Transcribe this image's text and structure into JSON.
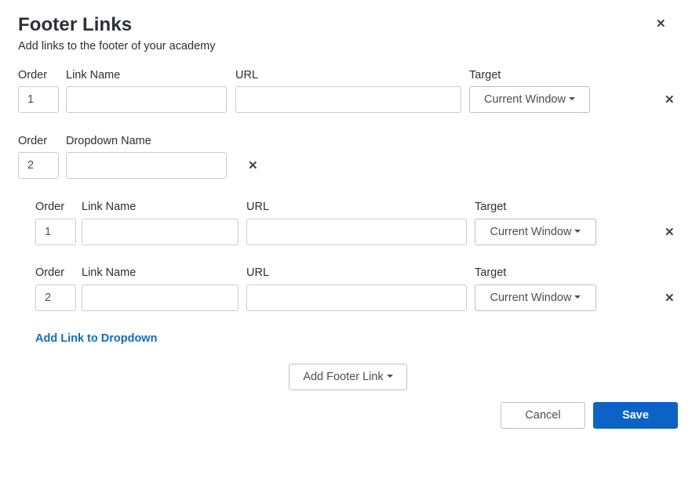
{
  "modal": {
    "title": "Footer Links",
    "subtitle": "Add links to the footer of your academy",
    "close_icon": "close-icon"
  },
  "labels": {
    "order": "Order",
    "link_name": "Link Name",
    "url": "URL",
    "target": "Target",
    "dropdown_name": "Dropdown Name"
  },
  "link1": {
    "order": "1",
    "link_name": "",
    "url": "",
    "target": "Current Window"
  },
  "dropdown1": {
    "order": "2",
    "name": "",
    "links": [
      {
        "order": "1",
        "link_name": "",
        "url": "",
        "target": "Current Window"
      },
      {
        "order": "2",
        "link_name": "",
        "url": "",
        "target": "Current Window"
      }
    ],
    "add_link_label": "Add Link to Dropdown"
  },
  "add_footer_link_label": "Add Footer Link",
  "buttons": {
    "cancel": "Cancel",
    "save": "Save"
  },
  "colors": {
    "primary": "#0b63c5",
    "link": "#1569c7"
  }
}
